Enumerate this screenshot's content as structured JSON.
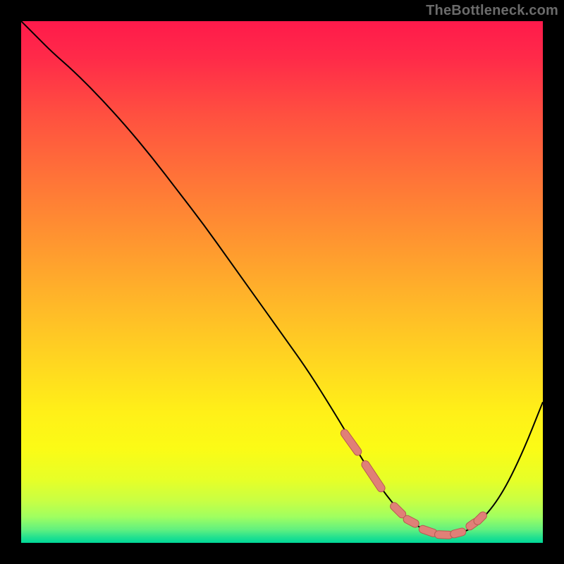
{
  "watermark": "TheBottleneck.com",
  "colors": {
    "black": "#000000",
    "curve": "#000000",
    "marker_fill": "#e08077",
    "marker_stroke": "#b85a52",
    "gradient_stops": [
      {
        "offset": 0.0,
        "color": "#ff1a4b"
      },
      {
        "offset": 0.07,
        "color": "#ff2a49"
      },
      {
        "offset": 0.18,
        "color": "#ff5040"
      },
      {
        "offset": 0.3,
        "color": "#ff7338"
      },
      {
        "offset": 0.42,
        "color": "#ff9530"
      },
      {
        "offset": 0.55,
        "color": "#ffba28"
      },
      {
        "offset": 0.66,
        "color": "#ffd820"
      },
      {
        "offset": 0.75,
        "color": "#fff018"
      },
      {
        "offset": 0.82,
        "color": "#fbfb16"
      },
      {
        "offset": 0.88,
        "color": "#e6ff28"
      },
      {
        "offset": 0.92,
        "color": "#c8ff44"
      },
      {
        "offset": 0.95,
        "color": "#a0ff60"
      },
      {
        "offset": 0.975,
        "color": "#60f080"
      },
      {
        "offset": 0.99,
        "color": "#20e090"
      },
      {
        "offset": 1.0,
        "color": "#00d898"
      }
    ]
  },
  "chart_data": {
    "type": "line",
    "title": "",
    "xlabel": "",
    "ylabel": "",
    "xlim": [
      0,
      100
    ],
    "ylim": [
      0,
      100
    ],
    "grid": false,
    "legend": false,
    "series": [
      {
        "name": "curve",
        "x": [
          0,
          3,
          6,
          10,
          15,
          20,
          25,
          30,
          35,
          40,
          45,
          50,
          55,
          60,
          63,
          66,
          70,
          74,
          78,
          82,
          85,
          88,
          92,
          96,
          100
        ],
        "y": [
          100,
          97,
          94,
          90.5,
          85.5,
          80,
          74,
          67.5,
          61,
          54,
          47,
          40,
          33,
          25,
          20,
          15,
          9,
          4.5,
          2,
          1.5,
          2,
          4,
          9,
          17,
          27
        ]
      }
    ],
    "markers": {
      "name": "optimal-segments",
      "segments": [
        {
          "x": [
            62,
            64.5
          ],
          "y": [
            21,
            17.5
          ]
        },
        {
          "x": [
            66,
            69
          ],
          "y": [
            15,
            10.5
          ]
        },
        {
          "x": [
            71.5,
            73
          ],
          "y": [
            7,
            5.5
          ]
        },
        {
          "x": [
            74,
            75.5
          ],
          "y": [
            4.5,
            3.7
          ]
        },
        {
          "x": [
            77,
            79
          ],
          "y": [
            2.6,
            1.9
          ]
        },
        {
          "x": [
            80,
            82
          ],
          "y": [
            1.6,
            1.5
          ]
        },
        {
          "x": [
            83,
            84.5
          ],
          "y": [
            1.7,
            2.1
          ]
        },
        {
          "x": [
            86,
            87
          ],
          "y": [
            3.2,
            3.9
          ]
        },
        {
          "x": [
            87.5,
            88.5
          ],
          "y": [
            4.2,
            5.2
          ]
        }
      ]
    }
  }
}
